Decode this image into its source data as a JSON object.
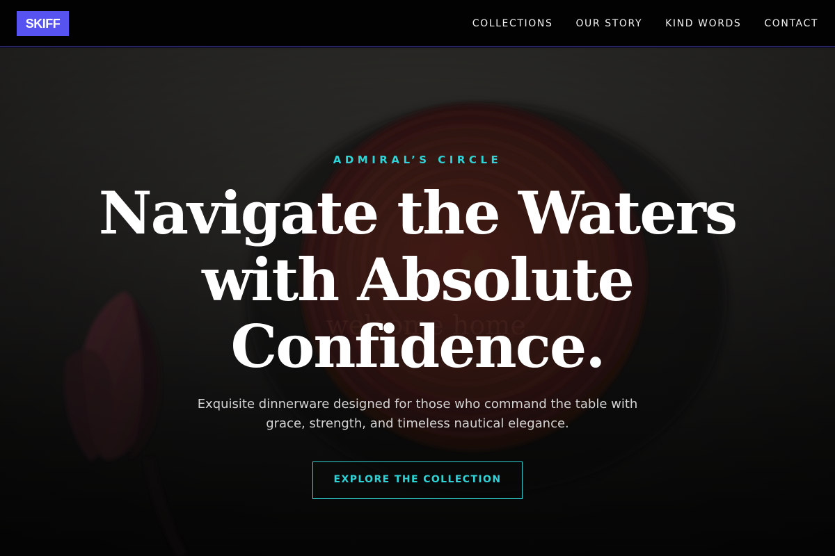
{
  "brand": {
    "logo_text": "SKIFF",
    "accent_color": "#5653f0",
    "highlight_color": "#2fd3d6"
  },
  "nav": {
    "items": [
      {
        "label": "COLLECTIONS"
      },
      {
        "label": "OUR STORY"
      },
      {
        "label": "KIND WORDS"
      },
      {
        "label": "CONTACT"
      }
    ]
  },
  "hero": {
    "eyebrow": "ADMIRAL’S CIRCLE",
    "headline": "Navigate the Waters with Absolute Confidence.",
    "subtext": "Exquisite dinnerware designed for those who command the table with grace, strength, and timeless nautical elegance.",
    "cta_label": "EXPLORE THE COLLECTION",
    "background_image": "dark photo of a terracotta ridged plate with a pink lotus bud"
  }
}
